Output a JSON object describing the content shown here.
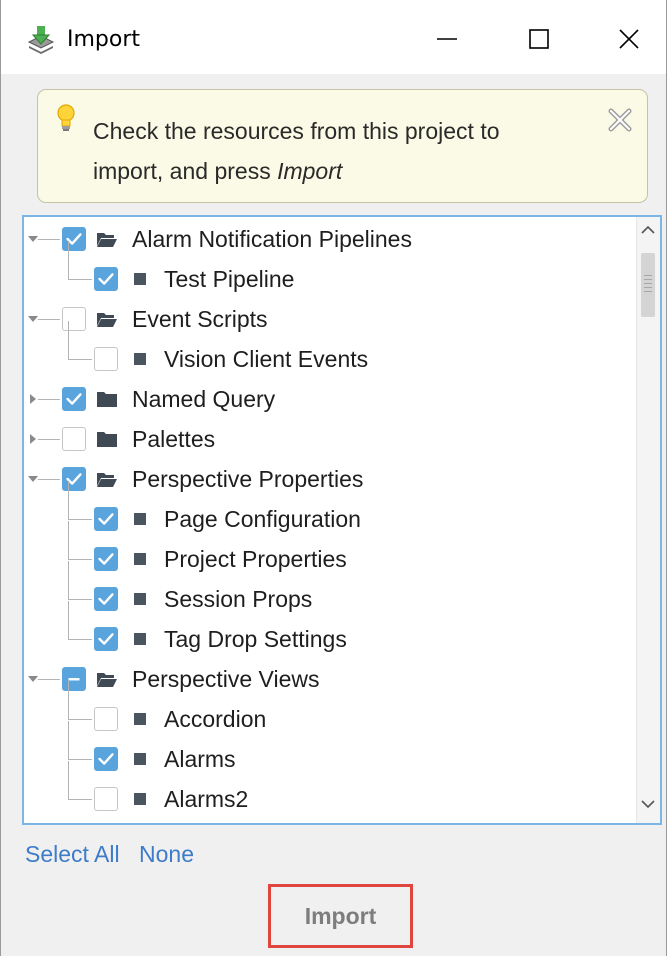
{
  "window": {
    "title": "Import",
    "icons": {
      "app": "download-icon",
      "minimize": "minimize-icon",
      "maximize": "maximize-icon",
      "close": "close-icon"
    }
  },
  "info": {
    "text_prefix": "Check the resources from this project to import, and press ",
    "text_emphasis": "Import",
    "icons": {
      "hint": "lightbulb-icon",
      "dismiss": "dismiss-icon"
    }
  },
  "tree": {
    "items": [
      {
        "label": "Alarm Notification Pipelines",
        "level": 0,
        "expander": "expanded",
        "state": "checked",
        "icon": "folder-open-icon"
      },
      {
        "label": "Test Pipeline",
        "level": 1,
        "expander": "none",
        "state": "checked",
        "icon": "resource-icon"
      },
      {
        "label": "Event Scripts",
        "level": 0,
        "expander": "expanded",
        "state": "unchecked",
        "icon": "folder-open-icon"
      },
      {
        "label": "Vision Client Events",
        "level": 1,
        "expander": "none",
        "state": "unchecked",
        "icon": "resource-icon"
      },
      {
        "label": "Named Query",
        "level": 0,
        "expander": "collapsed",
        "state": "checked",
        "icon": "folder-closed-icon"
      },
      {
        "label": "Palettes",
        "level": 0,
        "expander": "collapsed",
        "state": "unchecked",
        "icon": "folder-closed-icon"
      },
      {
        "label": "Perspective Properties",
        "level": 0,
        "expander": "expanded",
        "state": "checked",
        "icon": "folder-open-icon"
      },
      {
        "label": "Page Configuration",
        "level": 1,
        "expander": "none",
        "state": "checked",
        "icon": "resource-icon"
      },
      {
        "label": "Project Properties",
        "level": 1,
        "expander": "none",
        "state": "checked",
        "icon": "resource-icon"
      },
      {
        "label": "Session Props",
        "level": 1,
        "expander": "none",
        "state": "checked",
        "icon": "resource-icon"
      },
      {
        "label": "Tag Drop Settings",
        "level": 1,
        "expander": "none",
        "state": "checked",
        "icon": "resource-icon"
      },
      {
        "label": "Perspective Views",
        "level": 0,
        "expander": "expanded",
        "state": "partial",
        "icon": "folder-open-icon"
      },
      {
        "label": "Accordion",
        "level": 1,
        "expander": "none",
        "state": "unchecked",
        "icon": "resource-icon"
      },
      {
        "label": "Alarms",
        "level": 1,
        "expander": "none",
        "state": "checked",
        "icon": "resource-icon"
      },
      {
        "label": "Alarms2",
        "level": 1,
        "expander": "none",
        "state": "unchecked",
        "icon": "resource-icon"
      }
    ]
  },
  "selection": {
    "select_all": "Select All",
    "none": "None"
  },
  "actions": {
    "import": "Import"
  },
  "colors": {
    "accent": "#5aa4dd",
    "link": "#3d7cc9",
    "panel_border": "#7bb6e6",
    "highlight_border": "#e0453d",
    "info_background": "#fafae6"
  }
}
